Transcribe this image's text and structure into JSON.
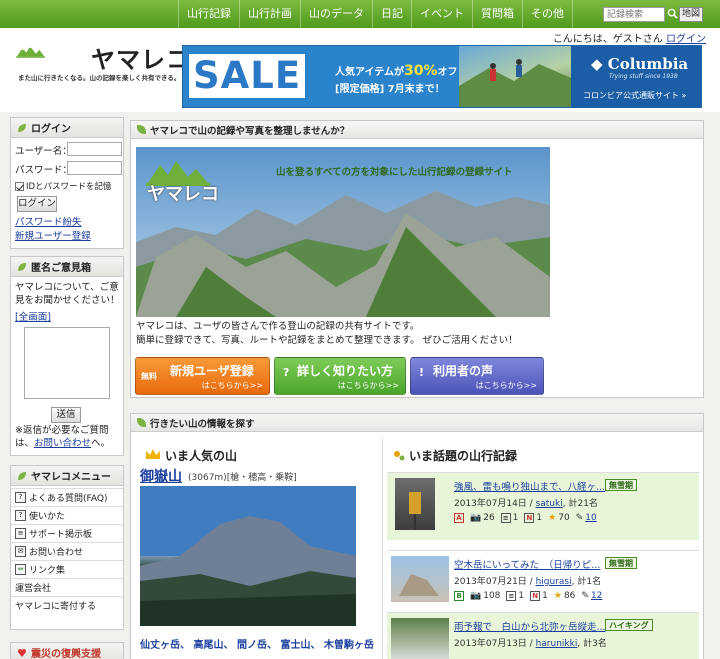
{
  "nav": {
    "items": [
      "山行記録",
      "山行計画",
      "山のデータ",
      "日記",
      "イベント",
      "質問箱",
      "その他"
    ],
    "search_placeholder": "記録検索",
    "map_label": "地図"
  },
  "header": {
    "logo_text": "ヤマレコ",
    "tagline": "また山に行きたくなる。山の記録を楽しく共有できる。",
    "greeting": "こんにちは、ゲストさん",
    "login_link": "ログイン"
  },
  "banner": {
    "sale": "SALE",
    "line1_pre": "人気アイテムが",
    "line1_pct": "30%",
    "line1_post": "オフ",
    "line2": "[限定価格] 7月末まで！",
    "brand": "Columbia",
    "brand_tag": "Trying stuff since 1938",
    "shop": "コロンビア公式通販サイト »"
  },
  "login": {
    "title": "ログイン",
    "user_label": "ユーザー名：",
    "pass_label": "パスワード：",
    "remember": "IDとパスワードを記憶",
    "button": "ログイン",
    "forgot": "パスワード紛失",
    "register": "新規ユーザー登録"
  },
  "feedback": {
    "title": "匿名ご意見箱",
    "text": "ヤマレコについて、ご意見をお聞かせください！",
    "fullscreen": "[全画面]",
    "send": "送信",
    "note_pre": "※返信が必要なご質問は、",
    "note_link": "お問い合わせ",
    "note_post": "へ。"
  },
  "menu": {
    "title": "ヤマレコメニュー",
    "items": [
      {
        "icon": "?",
        "label": "よくある質問(FAQ)"
      },
      {
        "icon": "?",
        "label": "使いかた"
      },
      {
        "icon": "≡",
        "label": "サポート掲示板"
      },
      {
        "icon": "✉",
        "label": "お問い合わせ"
      },
      {
        "icon": "⇔",
        "label": "リンク集"
      },
      {
        "icon": "",
        "label": "運営会社"
      },
      {
        "icon": "",
        "label": "ヤマレコに寄付する"
      }
    ],
    "next_title": "震災の復興支援"
  },
  "intro": {
    "title": "ヤマレコで山の記録や写真を整理しませんか？",
    "hero_logo": "ヤマレコ",
    "hero_copy": "山を登るすべての方を対象にした山行記録の登録サイト",
    "desc1": "ヤマレコは、ユーザの皆さんで作る登山の記録の共有サイトです。",
    "desc2": "簡単に登録できて、写真、ルートや記録をまとめて整理できます。 ぜひご活用ください！",
    "buttons": [
      {
        "prefix": "無料",
        "title": "新規ユーザ登録",
        "sub": "はこちらから>>",
        "color": "#f07a18"
      },
      {
        "prefix": "?",
        "title": "詳しく知りたい方",
        "sub": "はこちらから>>",
        "color": "#58b43c"
      },
      {
        "prefix": "!",
        "title": "利用者の声",
        "sub": "はこちらから>>",
        "color": "#5a64c8"
      }
    ]
  },
  "explore": {
    "title": "行きたい山の情報を探す",
    "popular_title": "いま人気の山",
    "mountain_name": "御嶽山",
    "mountain_meta": "(3067m)[槍・穂高・乗鞍]",
    "mountain_list": "仙丈ヶ岳、 高尾山、 間ノ岳、 富士山、 木曽駒ヶ岳",
    "records_title": "いま話題の山行記録",
    "records": [
      {
        "title": "強風、雷も鳴り独山まで、八経ヶ...",
        "tag": "無雪期",
        "date": "2013年07月14日 /",
        "user": "satuki",
        "count": "計21名",
        "s1": "26",
        "s2": "1",
        "s3": "1",
        "s4": "70",
        "s5": "10"
      },
      {
        "title": "空木岳にいってみた　（日帰りピ...",
        "tag": "無雪期",
        "date": "2013年07月21日 /",
        "user": "higurasi",
        "count": "計1名",
        "s1": "108",
        "s2": "1",
        "s3": "1",
        "s4": "86",
        "s5": "12"
      },
      {
        "title": "雨予報で　白山から北弥ヶ岳縦走...",
        "tag": "ハイキング",
        "date": "2013年07月13日 /",
        "user": "harunikki",
        "count": "計3名",
        "s1": "",
        "s2": "",
        "s3": "",
        "s4": "",
        "s5": ""
      }
    ]
  },
  "colors": {
    "nav": "#5fa82a",
    "accent": "#7cb342",
    "link": "#1a3f9e"
  }
}
